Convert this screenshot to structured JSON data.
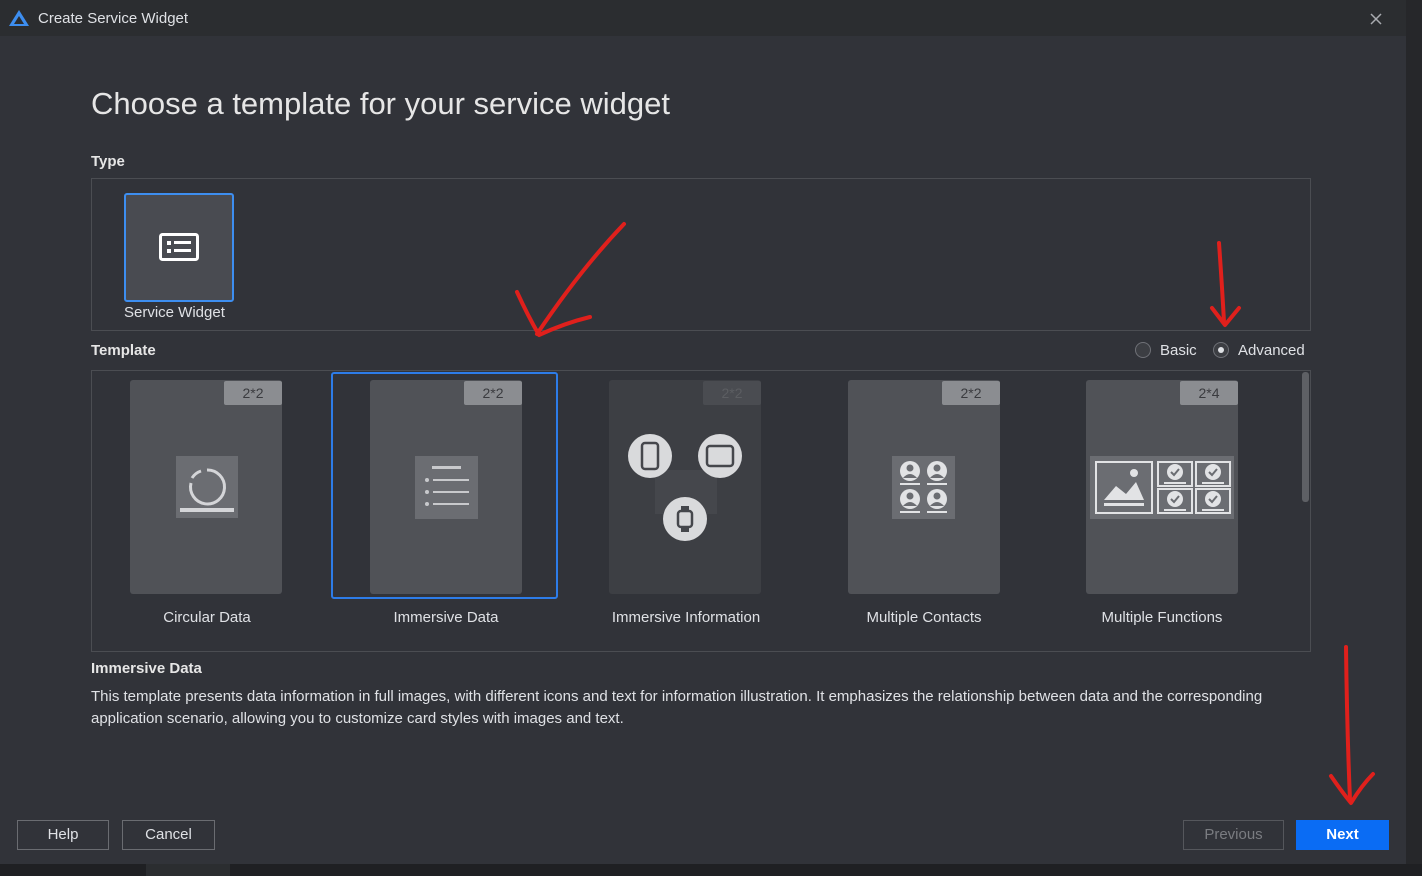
{
  "window": {
    "title": "Create Service Widget"
  },
  "heading": "Choose a template for your service widget",
  "type_section": {
    "label": "Type",
    "items": [
      {
        "label": "Service Widget",
        "selected": true
      }
    ]
  },
  "template_section": {
    "label": "Template",
    "modes": [
      {
        "label": "Basic",
        "checked": false
      },
      {
        "label": "Advanced",
        "checked": true
      }
    ],
    "templates": [
      {
        "label": "Circular Data",
        "size": "2*2",
        "icon": "circular-data-icon",
        "selected": false,
        "enabled": true
      },
      {
        "label": "Immersive Data",
        "size": "2*2",
        "icon": "immersive-data-icon",
        "selected": true,
        "enabled": true
      },
      {
        "label": "Immersive Information",
        "size": "2*2",
        "icon": "immersive-information-icon",
        "selected": false,
        "enabled": false
      },
      {
        "label": "Multiple Contacts",
        "size": "2*2",
        "icon": "multiple-contacts-icon",
        "selected": false,
        "enabled": true
      },
      {
        "label": "Multiple Functions",
        "size": "2*4",
        "icon": "multiple-functions-icon",
        "selected": false,
        "enabled": true
      }
    ]
  },
  "description": {
    "title": "Immersive Data",
    "text": "This template presents data information in full images, with different icons and text for information illustration. It emphasizes the relationship between data and the corresponding application scenario, allowing you to customize card styles with images and text."
  },
  "buttons": {
    "help": "Help",
    "cancel": "Cancel",
    "previous": "Previous",
    "next": "Next"
  },
  "colors": {
    "accent": "#0a6cf4",
    "selection_border": "#2d7ce8",
    "background": "#313339",
    "annotation": "#e0201c"
  }
}
